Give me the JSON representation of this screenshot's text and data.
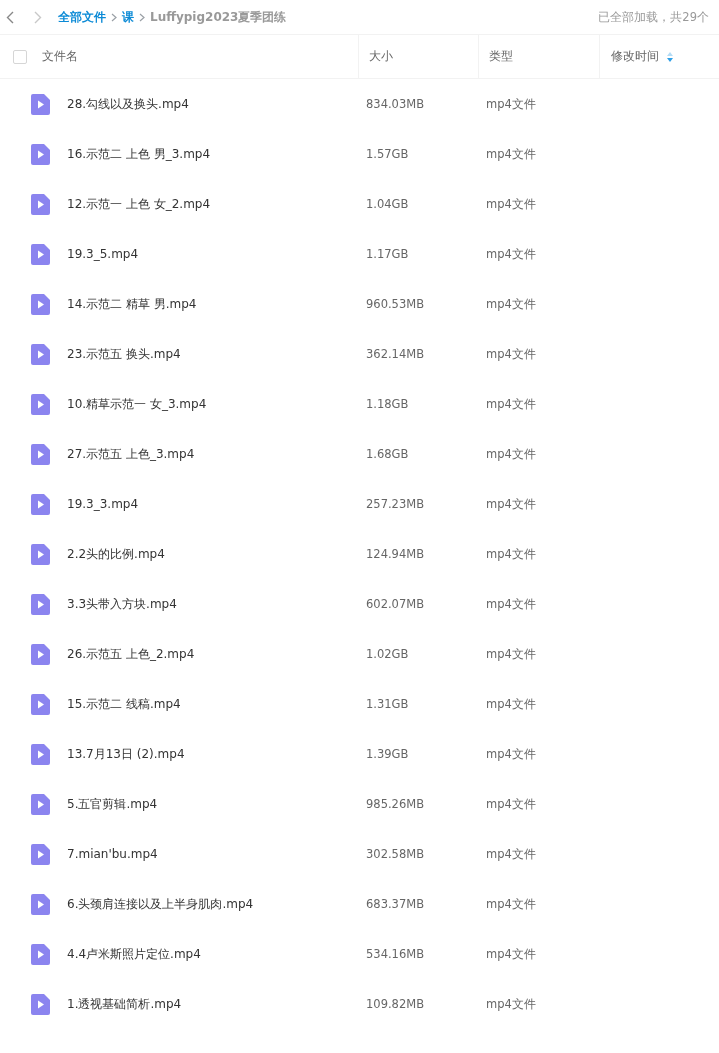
{
  "nav": {
    "back": {
      "disabled": false
    },
    "forward": {
      "disabled": true
    }
  },
  "breadcrumb": [
    {
      "label": "全部文件",
      "current": false
    },
    {
      "label": "课",
      "current": false
    },
    {
      "label": "Luffypig2023夏季团练",
      "current": true
    }
  ],
  "load_status": "已全部加载，共29个",
  "table": {
    "select_all": {
      "checked": false
    },
    "columns": [
      {
        "label": "文件名",
        "sortable": false
      },
      {
        "label": "大小",
        "sortable": false
      },
      {
        "label": "类型",
        "sortable": false
      },
      {
        "label": "修改时间",
        "sortable": true
      }
    ],
    "rows": [
      {
        "name": "28.勾线以及换头.mp4",
        "size": "834.03MB",
        "type": "mp4文件"
      },
      {
        "name": "16.示范二 上色 男_3.mp4",
        "size": "1.57GB",
        "type": "mp4文件"
      },
      {
        "name": "12.示范一 上色 女_2.mp4",
        "size": "1.04GB",
        "type": "mp4文件"
      },
      {
        "name": "19.3_5.mp4",
        "size": "1.17GB",
        "type": "mp4文件"
      },
      {
        "name": "14.示范二 精草 男.mp4",
        "size": "960.53MB",
        "type": "mp4文件"
      },
      {
        "name": "23.示范五 换头.mp4",
        "size": "362.14MB",
        "type": "mp4文件"
      },
      {
        "name": "10.精草示范一 女_3.mp4",
        "size": "1.18GB",
        "type": "mp4文件"
      },
      {
        "name": "27.示范五 上色_3.mp4",
        "size": "1.68GB",
        "type": "mp4文件"
      },
      {
        "name": "19.3_3.mp4",
        "size": "257.23MB",
        "type": "mp4文件"
      },
      {
        "name": "2.2头的比例.mp4",
        "size": "124.94MB",
        "type": "mp4文件"
      },
      {
        "name": "3.3头带入方块.mp4",
        "size": "602.07MB",
        "type": "mp4文件"
      },
      {
        "name": "26.示范五 上色_2.mp4",
        "size": "1.02GB",
        "type": "mp4文件"
      },
      {
        "name": "15.示范二 线稿.mp4",
        "size": "1.31GB",
        "type": "mp4文件"
      },
      {
        "name": "13.7月13日 (2).mp4",
        "size": "1.39GB",
        "type": "mp4文件"
      },
      {
        "name": "5.五官剪辑.mp4",
        "size": "985.26MB",
        "type": "mp4文件"
      },
      {
        "name": "7.mian'bu.mp4",
        "size": "302.58MB",
        "type": "mp4文件"
      },
      {
        "name": "6.头颈肩连接以及上半身肌肉.mp4",
        "size": "683.37MB",
        "type": "mp4文件"
      },
      {
        "name": "4.4卢米斯照片定位.mp4",
        "size": "534.16MB",
        "type": "mp4文件"
      },
      {
        "name": "1.透视基础简析.mp4",
        "size": "109.82MB",
        "type": "mp4文件"
      }
    ]
  }
}
